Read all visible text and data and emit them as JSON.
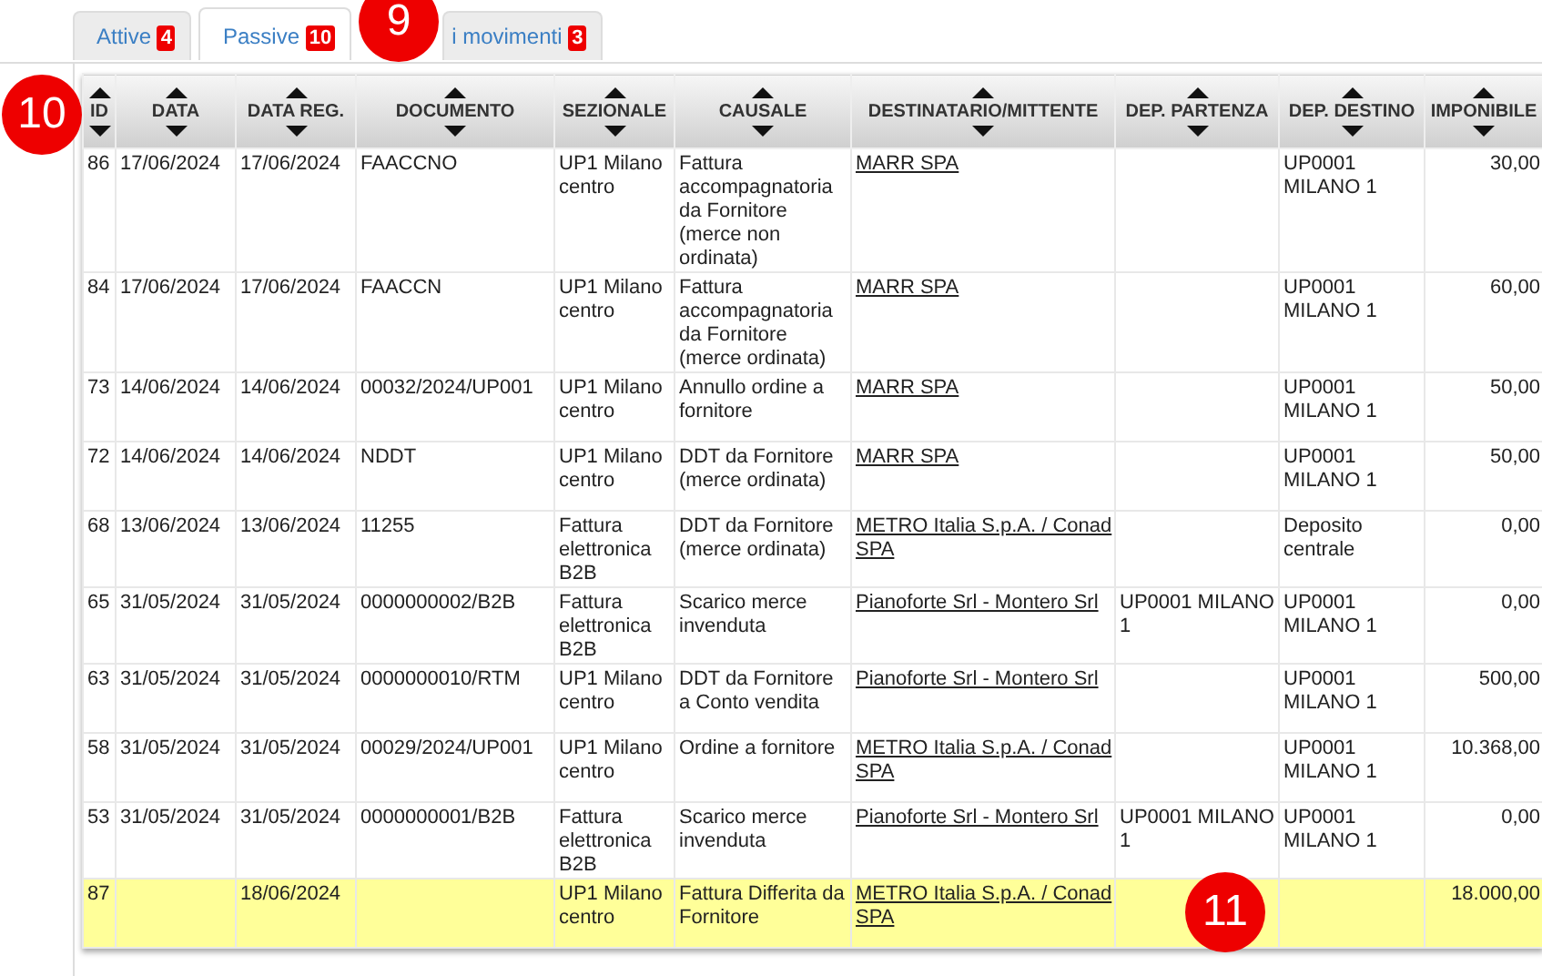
{
  "tabs": [
    {
      "label": "Attive",
      "count": "4",
      "selected": false
    },
    {
      "label": "Passive",
      "count": "10",
      "selected": true
    },
    {
      "label": "i movimenti",
      "count": "3",
      "selected": false,
      "callout": "9"
    }
  ],
  "table": {
    "columns": [
      {
        "label": "ID",
        "callout": "10"
      },
      {
        "label": "DATA"
      },
      {
        "label": "DATA REG."
      },
      {
        "label": "DOCUMENTO"
      },
      {
        "label": "SEZIONALE"
      },
      {
        "label": "CAUSALE"
      },
      {
        "label": "DESTINATARIO/MITTENTE"
      },
      {
        "label": "DEP. PARTENZA"
      },
      {
        "label": "DEP. DESTINO"
      },
      {
        "label": "IMPONIBILE"
      }
    ],
    "rows": [
      {
        "id": "86",
        "data": "17/06/2024",
        "data_reg": "17/06/2024",
        "documento": "FAACCNO",
        "sezionale": "UP1 Milano centro",
        "causale": "Fattura accompagnatoria da Fornitore (merce non ordinata)",
        "destinatario": "MARR SPA",
        "dep_partenza": "",
        "dep_destino": "UP0001 MILANO 1",
        "imponibile": "30,00",
        "highlighted": false
      },
      {
        "id": "84",
        "data": "17/06/2024",
        "data_reg": "17/06/2024",
        "documento": "FAACCN",
        "sezionale": "UP1 Milano centro",
        "causale": "Fattura accompagnatoria da Fornitore (merce ordinata)",
        "destinatario": "MARR SPA",
        "dep_partenza": "",
        "dep_destino": "UP0001 MILANO 1",
        "imponibile": "60,00",
        "highlighted": false
      },
      {
        "id": "73",
        "data": "14/06/2024",
        "data_reg": "14/06/2024",
        "documento": "00032/2024/UP001",
        "sezionale": "UP1 Milano centro",
        "causale": "Annullo ordine a fornitore",
        "destinatario": "MARR SPA",
        "dep_partenza": "",
        "dep_destino": "UP0001 MILANO 1",
        "imponibile": "50,00",
        "highlighted": false
      },
      {
        "id": "72",
        "data": "14/06/2024",
        "data_reg": "14/06/2024",
        "documento": "NDDT",
        "sezionale": "UP1 Milano centro",
        "causale": "DDT da Fornitore (merce ordinata)",
        "destinatario": "MARR SPA",
        "dep_partenza": "",
        "dep_destino": "UP0001 MILANO 1",
        "imponibile": "50,00",
        "highlighted": false
      },
      {
        "id": "68",
        "data": "13/06/2024",
        "data_reg": "13/06/2024",
        "documento": "11255",
        "sezionale": "Fattura elettronica B2B",
        "causale": "DDT da Fornitore (merce ordinata)",
        "destinatario": "METRO Italia S.p.A. / Conad SPA",
        "dep_partenza": "",
        "dep_destino": "Deposito centrale",
        "imponibile": "0,00",
        "highlighted": false
      },
      {
        "id": "65",
        "data": "31/05/2024",
        "data_reg": "31/05/2024",
        "documento": "0000000002/B2B",
        "sezionale": "Fattura elettronica B2B",
        "causale": "Scarico merce invenduta",
        "destinatario": "Pianoforte Srl - Montero Srl",
        "dep_partenza": "UP0001 MILANO 1",
        "dep_destino": "UP0001 MILANO 1",
        "imponibile": "0,00",
        "highlighted": false
      },
      {
        "id": "63",
        "data": "31/05/2024",
        "data_reg": "31/05/2024",
        "documento": "0000000010/RTM",
        "sezionale": "UP1 Milano centro",
        "causale": "DDT da Fornitore a Conto vendita",
        "destinatario": "Pianoforte Srl - Montero Srl",
        "dep_partenza": "",
        "dep_destino": "UP0001 MILANO 1",
        "imponibile": "500,00",
        "highlighted": false
      },
      {
        "id": "58",
        "data": "31/05/2024",
        "data_reg": "31/05/2024",
        "documento": "00029/2024/UP001",
        "sezionale": "UP1 Milano centro",
        "causale": "Ordine a fornitore",
        "destinatario": "METRO Italia S.p.A. / Conad SPA",
        "dep_partenza": "",
        "dep_destino": "UP0001 MILANO 1",
        "imponibile": "10.368,00",
        "highlighted": false
      },
      {
        "id": "53",
        "data": "31/05/2024",
        "data_reg": "31/05/2024",
        "documento": "0000000001/B2B",
        "sezionale": "Fattura elettronica B2B",
        "causale": "Scarico merce invenduta",
        "destinatario": "Pianoforte Srl - Montero Srl",
        "dep_partenza": "UP0001 MILANO 1",
        "dep_destino": "UP0001 MILANO 1",
        "imponibile": "0,00",
        "highlighted": false
      },
      {
        "id": "87",
        "data": "",
        "data_reg": "18/06/2024",
        "documento": "",
        "sezionale": "UP1 Milano centro",
        "causale": "Fattura Differita da Fornitore",
        "destinatario": "METRO Italia S.p.A. / Conad SPA",
        "dep_partenza": "",
        "dep_destino": "",
        "imponibile": "18.000,00",
        "highlighted": true,
        "callout": "11"
      }
    ]
  }
}
